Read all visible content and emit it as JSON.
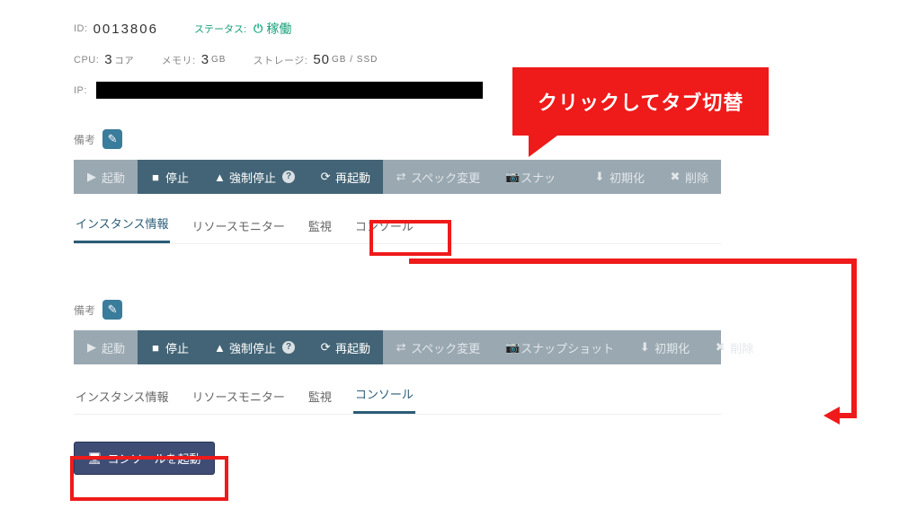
{
  "instance": {
    "id_label": "ID:",
    "id": "0013806",
    "status_label": "ステータス:",
    "status_text": "稼働",
    "cpu_label": "CPU:",
    "cpu_val": "3",
    "cpu_unit": "コア",
    "mem_label": "メモリ:",
    "mem_val": "3",
    "mem_unit": "GB",
    "storage_label": "ストレージ:",
    "storage_val": "50",
    "storage_unit": "GB / SSD",
    "ip_label": "IP:",
    "note_label": "備考"
  },
  "toolbar": {
    "start": "起動",
    "stop": "停止",
    "force_stop": "強制停止",
    "reboot": "再起動",
    "spec": "スペック変更",
    "snapshot": "スナップショット",
    "snapshot_short": "スナッ",
    "init": "初期化",
    "delete": "削除"
  },
  "tabs": {
    "info": "インスタンス情報",
    "monitor": "リソースモニター",
    "watch": "監視",
    "console": "コンソール"
  },
  "console_btn": "コンソールを起動",
  "callout": "クリックしてタブ切替"
}
